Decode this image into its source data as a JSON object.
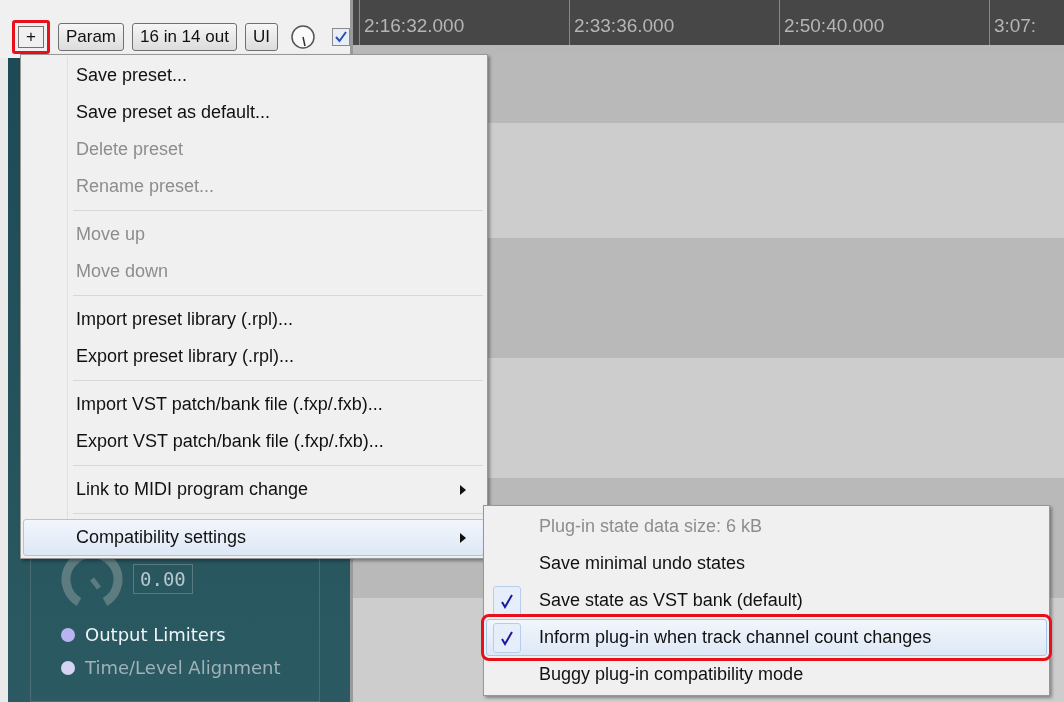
{
  "toolbar": {
    "buttons": [
      {
        "label": "+",
        "annotated": true
      },
      {
        "label": "Param",
        "annotated": false
      },
      {
        "label": "16 in 14 out",
        "annotated": false
      },
      {
        "label": "UI",
        "annotated": false
      }
    ],
    "enabled": {
      "checked": true
    }
  },
  "ruler": {
    "marks": [
      "2:16:32.000",
      "2:33:36.000",
      "2:50:40.000",
      "3:07:"
    ]
  },
  "plugin_panel": {
    "value": "0.00",
    "options": [
      {
        "label": "Output Limiters",
        "disabled": false
      },
      {
        "label": "Time/Level Alignment",
        "disabled": true
      }
    ]
  },
  "menu": {
    "items": [
      {
        "kind": "item",
        "label": "Save preset...",
        "disabled": false,
        "submenu": false,
        "highlighted": false
      },
      {
        "kind": "item",
        "label": "Save preset as default...",
        "disabled": false,
        "submenu": false,
        "highlighted": false
      },
      {
        "kind": "item",
        "label": "Delete preset",
        "disabled": true,
        "submenu": false,
        "highlighted": false
      },
      {
        "kind": "item",
        "label": "Rename preset...",
        "disabled": true,
        "submenu": false,
        "highlighted": false
      },
      {
        "kind": "separator"
      },
      {
        "kind": "item",
        "label": "Move up",
        "disabled": true,
        "submenu": false,
        "highlighted": false
      },
      {
        "kind": "item",
        "label": "Move down",
        "disabled": true,
        "submenu": false,
        "highlighted": false
      },
      {
        "kind": "separator"
      },
      {
        "kind": "item",
        "label": "Import preset library (.rpl)...",
        "disabled": false,
        "submenu": false,
        "highlighted": false
      },
      {
        "kind": "item",
        "label": "Export preset library (.rpl)...",
        "disabled": false,
        "submenu": false,
        "highlighted": false
      },
      {
        "kind": "separator"
      },
      {
        "kind": "item",
        "label": "Import VST patch/bank file (.fxp/.fxb)...",
        "disabled": false,
        "submenu": false,
        "highlighted": false
      },
      {
        "kind": "item",
        "label": "Export VST patch/bank file (.fxp/.fxb)...",
        "disabled": false,
        "submenu": false,
        "highlighted": false
      },
      {
        "kind": "separator"
      },
      {
        "kind": "item",
        "label": "Link to MIDI program change",
        "disabled": false,
        "submenu": true,
        "highlighted": false
      },
      {
        "kind": "separator"
      },
      {
        "kind": "item",
        "label": "Compatibility settings",
        "disabled": false,
        "submenu": true,
        "highlighted": true
      }
    ]
  },
  "submenu": {
    "items": [
      {
        "label": "Plug-in state data size:  6 kB",
        "disabled": true,
        "checked": false,
        "highlighted": false,
        "annotated": false
      },
      {
        "label": "Save minimal undo states",
        "disabled": false,
        "checked": false,
        "highlighted": false,
        "annotated": false
      },
      {
        "label": "Save state as VST bank (default)",
        "disabled": false,
        "checked": true,
        "highlighted": false,
        "annotated": false
      },
      {
        "label": "Inform plug-in when track channel count changes",
        "disabled": false,
        "checked": true,
        "highlighted": true,
        "annotated": true
      },
      {
        "label": "Buggy plug-in compatibility mode",
        "disabled": false,
        "checked": false,
        "highlighted": false,
        "annotated": false
      }
    ]
  }
}
